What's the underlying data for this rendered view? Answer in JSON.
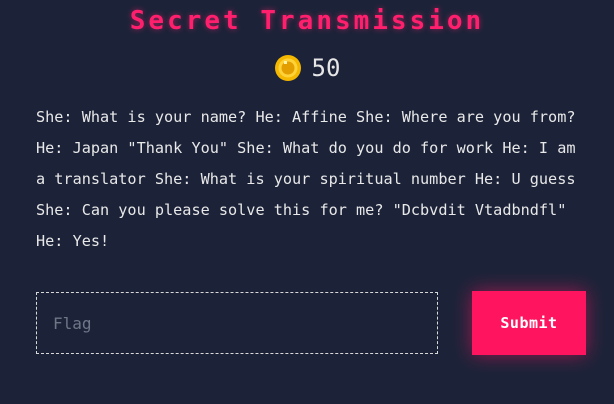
{
  "challenge": {
    "title": "Secret Transmission",
    "points": "50",
    "description": "She: What is your name? He: Affine She: Where are you from? He: Japan \"Thank You\" She: What do you do for work He: I am a translator She: What is your spiritual number He: U guess She: Can you please solve this for me? \"Dcbvdit Vtadbndfl\" He: Yes!"
  },
  "form": {
    "flag_placeholder": "Flag",
    "flag_value": "",
    "submit_label": "Submit"
  },
  "icons": {
    "points": "coin-icon"
  },
  "colors": {
    "background": "#1c2339",
    "accent": "#ff1460",
    "coin": "#f5b800"
  }
}
